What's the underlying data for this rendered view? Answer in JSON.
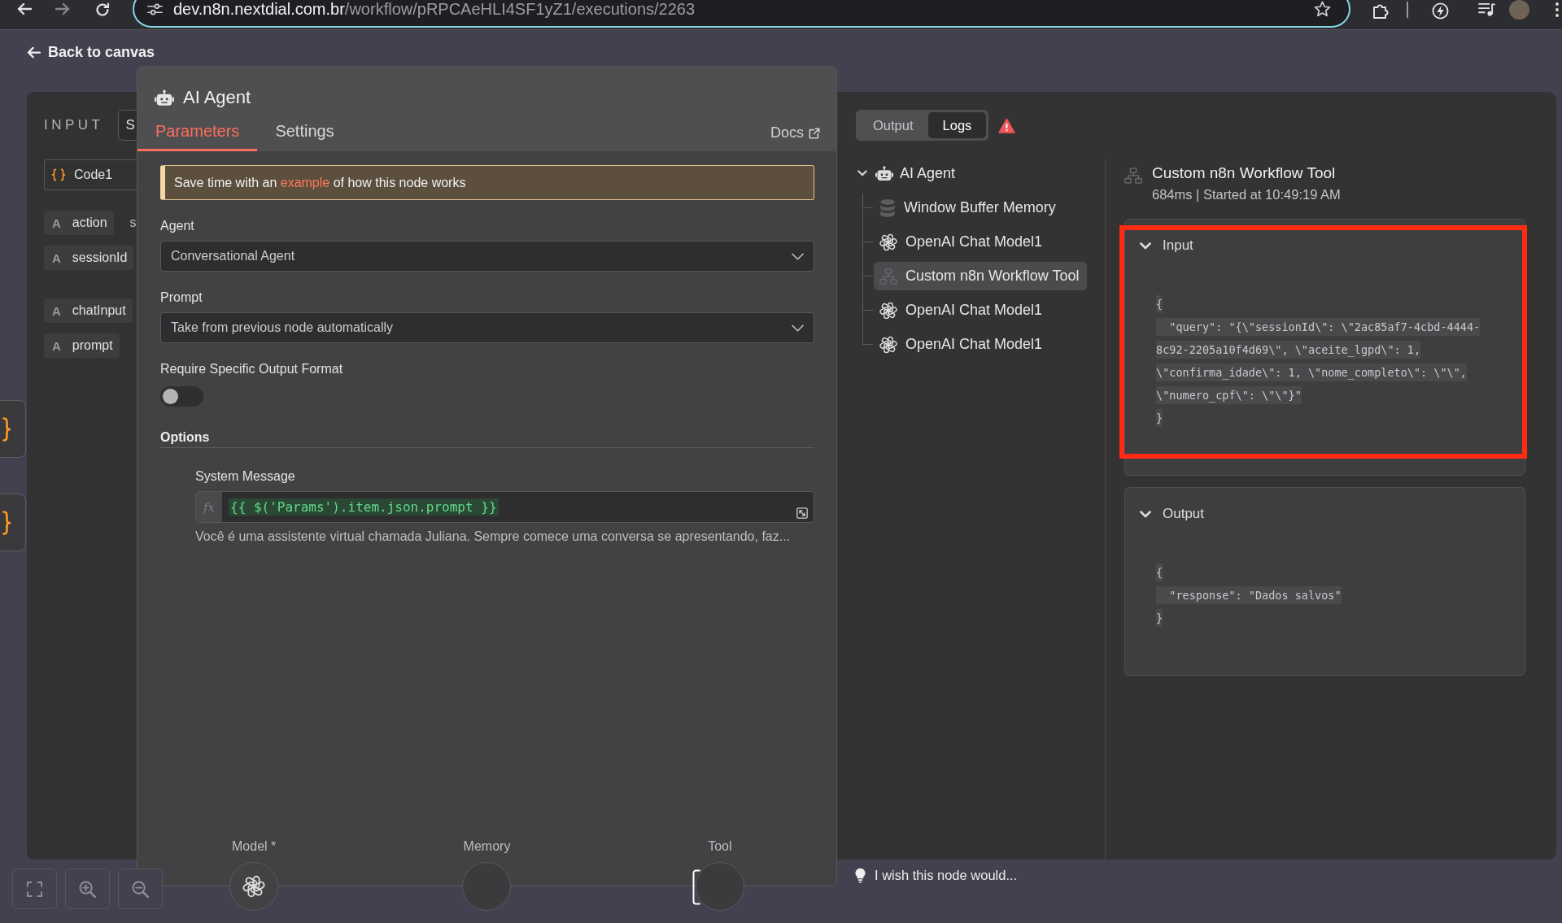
{
  "browser": {
    "url_host": "dev.n8n.nextdial.com.br",
    "url_path": "/workflow/pRPCAeHLI4SF1yZ1/executions/2263"
  },
  "back_link": "Back to canvas",
  "canvas_nodes": [
    {
      "kind": "code"
    },
    {
      "kind": "code"
    }
  ],
  "input_panel": {
    "title": "INPUT",
    "view_switch": {
      "label": "S",
      "selected": true
    },
    "source_node": "Code1",
    "field_groups": [
      [
        {
          "type": "A",
          "name": "action",
          "value": "s"
        },
        {
          "type": "A",
          "name": "sessionId"
        }
      ],
      [
        {
          "type": "A",
          "name": "chatInput"
        },
        {
          "type": "A",
          "name": "prompt"
        }
      ]
    ]
  },
  "node_panel": {
    "title": "AI Agent",
    "tabs": [
      {
        "label": "Parameters",
        "selected": true
      },
      {
        "label": "Settings",
        "selected": false
      }
    ],
    "docs": "Docs",
    "notice": {
      "before": "Save time with an ",
      "link": "example",
      "after": " of how this node works"
    },
    "parameters": [
      {
        "kind": "select",
        "label": "Agent",
        "value": "Conversational Agent"
      },
      {
        "kind": "select",
        "label": "Prompt",
        "value": "Take from previous node automatically"
      },
      {
        "kind": "toggle",
        "label": "Require Specific Output Format",
        "on": false
      }
    ],
    "options": {
      "title": "Options",
      "items": [
        {
          "label": "System Message",
          "fx": "fx",
          "expression": "{{ $('Params').item.json.prompt }}",
          "preview": "Você é uma assistente virtual chamada Juliana. Sempre comece uma conversa se apresentando, faz..."
        }
      ]
    },
    "connectors": [
      {
        "label": "Model *",
        "connected": true,
        "hovered": false
      },
      {
        "label": "Memory",
        "connected": false,
        "hovered": false
      },
      {
        "label": "Tool",
        "connected": false,
        "hovered": true
      }
    ]
  },
  "run_panel": {
    "view_tabs": [
      {
        "label": "Output",
        "selected": false
      },
      {
        "label": "Logs",
        "selected": true
      }
    ],
    "log_tree": {
      "label": "AI Agent",
      "expanded": true,
      "selected": false,
      "children": [
        {
          "label": "Window Buffer Memory",
          "kind": "memory",
          "selected": false
        },
        {
          "label": "OpenAI Chat Model1",
          "kind": "model",
          "selected": false
        },
        {
          "label": "Custom n8n Workflow Tool",
          "kind": "tool",
          "selected": true
        },
        {
          "label": "OpenAI Chat Model1",
          "kind": "model",
          "selected": false
        },
        {
          "label": "OpenAI Chat Model1",
          "kind": "model",
          "selected": false
        }
      ]
    },
    "detail": {
      "kind": "tool",
      "title": "Custom n8n Workflow Tool",
      "meta": "684ms | Started at 10:49:19 AM",
      "sections": [
        {
          "label": "Input",
          "expanded": true,
          "highlighted": true,
          "json_lines": [
            "{",
            "  \"query\": \"{\\\"sessionId\\\": \\\"2ac85af7-4cbd-4444-",
            "8c92-2205a10f4d69\\\", \\\"aceite_lgpd\\\": 1,",
            "\\\"confirma_idade\\\": 1, \\\"nome_completo\\\": \\\"\\\",",
            "\\\"numero_cpf\\\": \\\"\\\"}\"",
            "}"
          ]
        },
        {
          "label": "Output",
          "expanded": true,
          "highlighted": false,
          "json_lines": [
            "{",
            "  \"response\": \"Dados salvos\"",
            "}"
          ]
        }
      ]
    }
  },
  "feedback": "I wish this node would..."
}
